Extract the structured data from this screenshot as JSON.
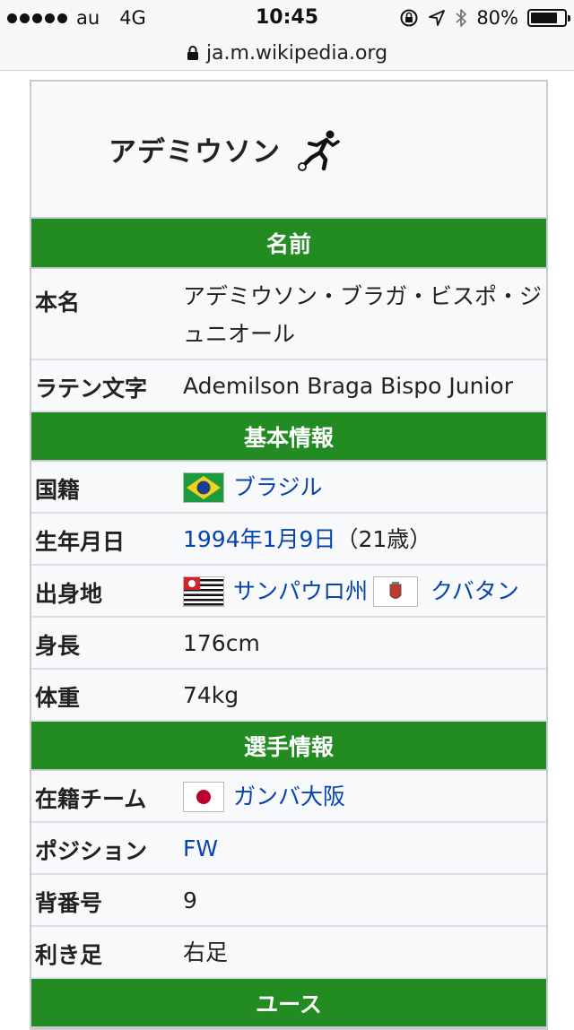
{
  "status_bar": {
    "carrier": "au",
    "network": "4G",
    "time": "10:45",
    "battery": "80%",
    "battery_level": 0.8
  },
  "url_bar": {
    "url": "ja.m.wikipedia.org"
  },
  "infobox": {
    "title": "アデミウソン",
    "sections": {
      "name": "名前",
      "basic": "基本情報",
      "player": "選手情報",
      "youth": "ユース"
    },
    "rows": {
      "real_name": {
        "label": "本名",
        "value": "アデミウソン・ブラガ・ビスポ・ジュニオール"
      },
      "latin": {
        "label": "ラテン文字",
        "value": "Ademilson Braga Bispo Junior"
      },
      "nationality": {
        "label": "国籍",
        "value": "ブラジル"
      },
      "birth_date": {
        "label": "生年月日",
        "value": "1994年1月9日",
        "age": "（21歳）"
      },
      "birthplace": {
        "label": "出身地",
        "state": "サンパウロ州",
        "city": "クバタン"
      },
      "height": {
        "label": "身長",
        "value": "176cm"
      },
      "weight": {
        "label": "体重",
        "value": "74kg"
      },
      "team": {
        "label": "在籍チーム",
        "value": "ガンバ大阪"
      },
      "position": {
        "label": "ポジション",
        "value": "FW"
      },
      "number": {
        "label": "背番号",
        "value": "9"
      },
      "foot": {
        "label": "利き足",
        "value": "右足"
      }
    }
  },
  "colors": {
    "section_header": "#228b22",
    "link": "#0645ad",
    "infobox_bg": "#f8f9fa",
    "border": "#c8ccd1"
  }
}
